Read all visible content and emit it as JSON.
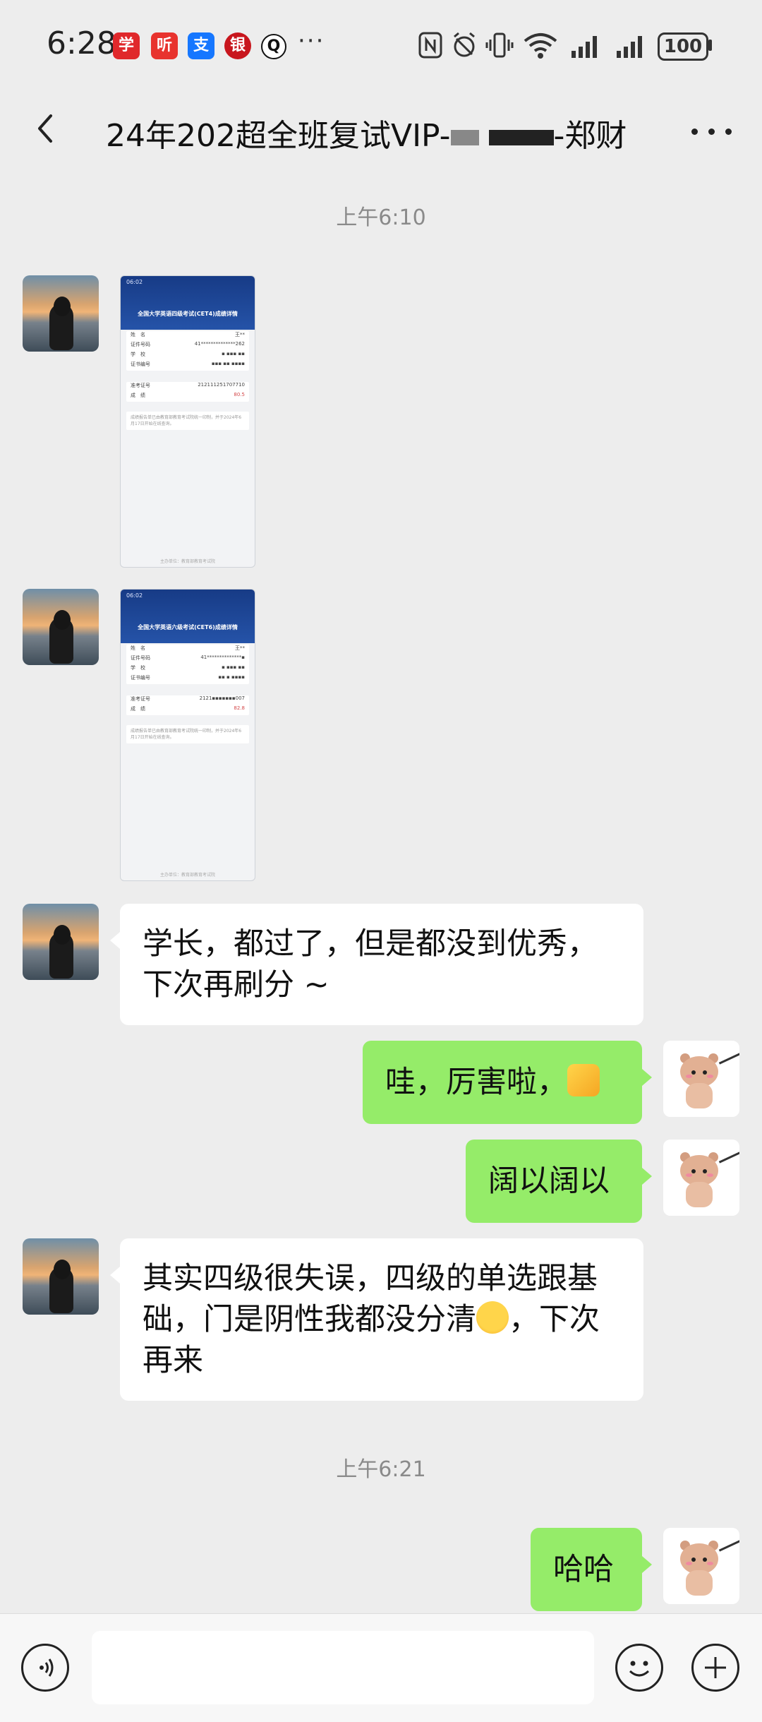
{
  "status_bar": {
    "time": "6:28",
    "app_icons": [
      {
        "name": "app-icon-red-1",
        "label": "学",
        "color": "#e0282b"
      },
      {
        "name": "app-icon-listen",
        "label": "听",
        "color": "#e8332e"
      },
      {
        "name": "app-icon-alipay",
        "label": "支",
        "color": "#1677ff"
      },
      {
        "name": "app-icon-bank",
        "label": "银",
        "color": "#c8161d"
      },
      {
        "name": "app-icon-qq",
        "label": "Q",
        "color": "#111111"
      }
    ],
    "more_dots": "···",
    "battery": "100"
  },
  "nav": {
    "title_prefix": "24年202超全班复试VIP-",
    "title_suffix": "-郑财"
  },
  "chat": {
    "timestamp_1": "上午6:10",
    "timestamp_2": "上午6:21",
    "shot_cet4": {
      "status": "06:02",
      "title": "全国大学英语四级考试(CET4)成绩详情",
      "rows": [
        {
          "label": "姓　名",
          "value": "王**"
        },
        {
          "label": "证件号码",
          "value": "41**************262"
        },
        {
          "label": "学　校",
          "value": "▪ ▪▪▪ ▪▪"
        },
        {
          "label": "证书编号",
          "value": "▪▪▪ ▪▪ ▪▪▪▪"
        }
      ],
      "ticket_label": "准考证号",
      "ticket_value": "212111251707710",
      "score_label": "成　绩",
      "score_value": "80.5",
      "note": "成绩报告单已由教育部教育考试院统一印制，并于2024年6月17日开始在线查询。",
      "footer": "主办单位：教育部教育考试院"
    },
    "shot_cet6": {
      "status": "06:02",
      "title": "全国大学英语六级考试(CET6)成绩详情",
      "rows": [
        {
          "label": "姓　名",
          "value": "王**"
        },
        {
          "label": "证件号码",
          "value": "41**************▪"
        },
        {
          "label": "学　校",
          "value": "▪ ▪▪▪ ▪▪"
        },
        {
          "label": "证书编号",
          "value": "▪▪ ▪ ▪▪▪▪"
        }
      ],
      "ticket_label": "准考证号",
      "ticket_value": "2121▪▪▪▪▪▪▪007",
      "score_label": "成　绩",
      "score_value": "82.8",
      "note": "成绩报告单已由教育部教育考试院统一印制，并于2024年6月17日开始在线查询。",
      "footer": "主办单位：教育部教育考试院"
    },
    "msg_1": "学长，都过了，但是都没到优秀，下次再刷分 ~",
    "msg_2": "哇，厉害啦，",
    "msg_3": "阔以阔以",
    "msg_4a": "其实四级很失误，四级的单选跟基础，门是阴性我都没分清",
    "msg_4b": "，下次再来",
    "msg_5": "哈哈"
  }
}
